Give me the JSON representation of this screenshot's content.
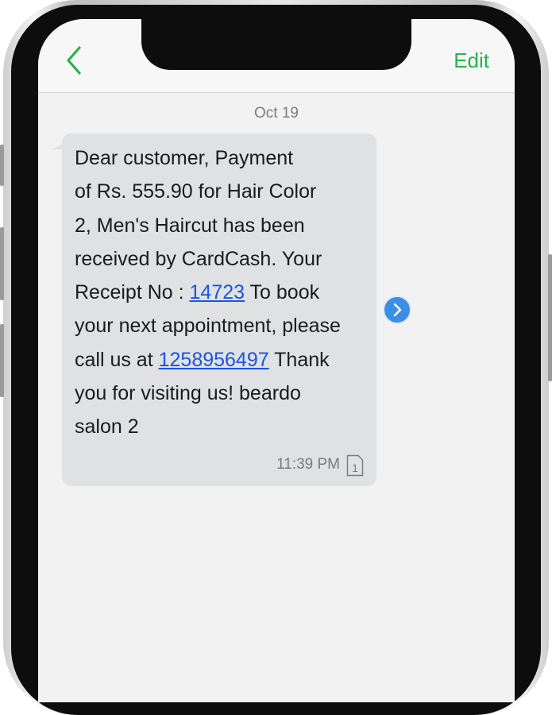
{
  "header": {
    "edit_label": "Edit",
    "back_icon": "chevron-left-icon"
  },
  "thread": {
    "date_label": "Oct 19"
  },
  "message": {
    "text_1": "Dear customer,   Payment\nof Rs. 555.90 for Hair Color\n2, Men's Haircut has been\nreceived by CardCash. Your\nReceipt No : ",
    "receipt_link": "14723",
    "text_2": "   To book\nyour next appointment, please\ncall us at ",
    "phone_link": "1258956497",
    "text_3": "  Thank\nyou for visiting us! beardo\nsalon 2",
    "time": "11:39 PM",
    "sim_slot": "1",
    "forward_icon": "chevron-right-circle-icon"
  },
  "colors": {
    "accent": "#27b34a",
    "link": "#1a55e0",
    "bubble": "#dfe1e3",
    "forward": "#3a8ee6"
  }
}
